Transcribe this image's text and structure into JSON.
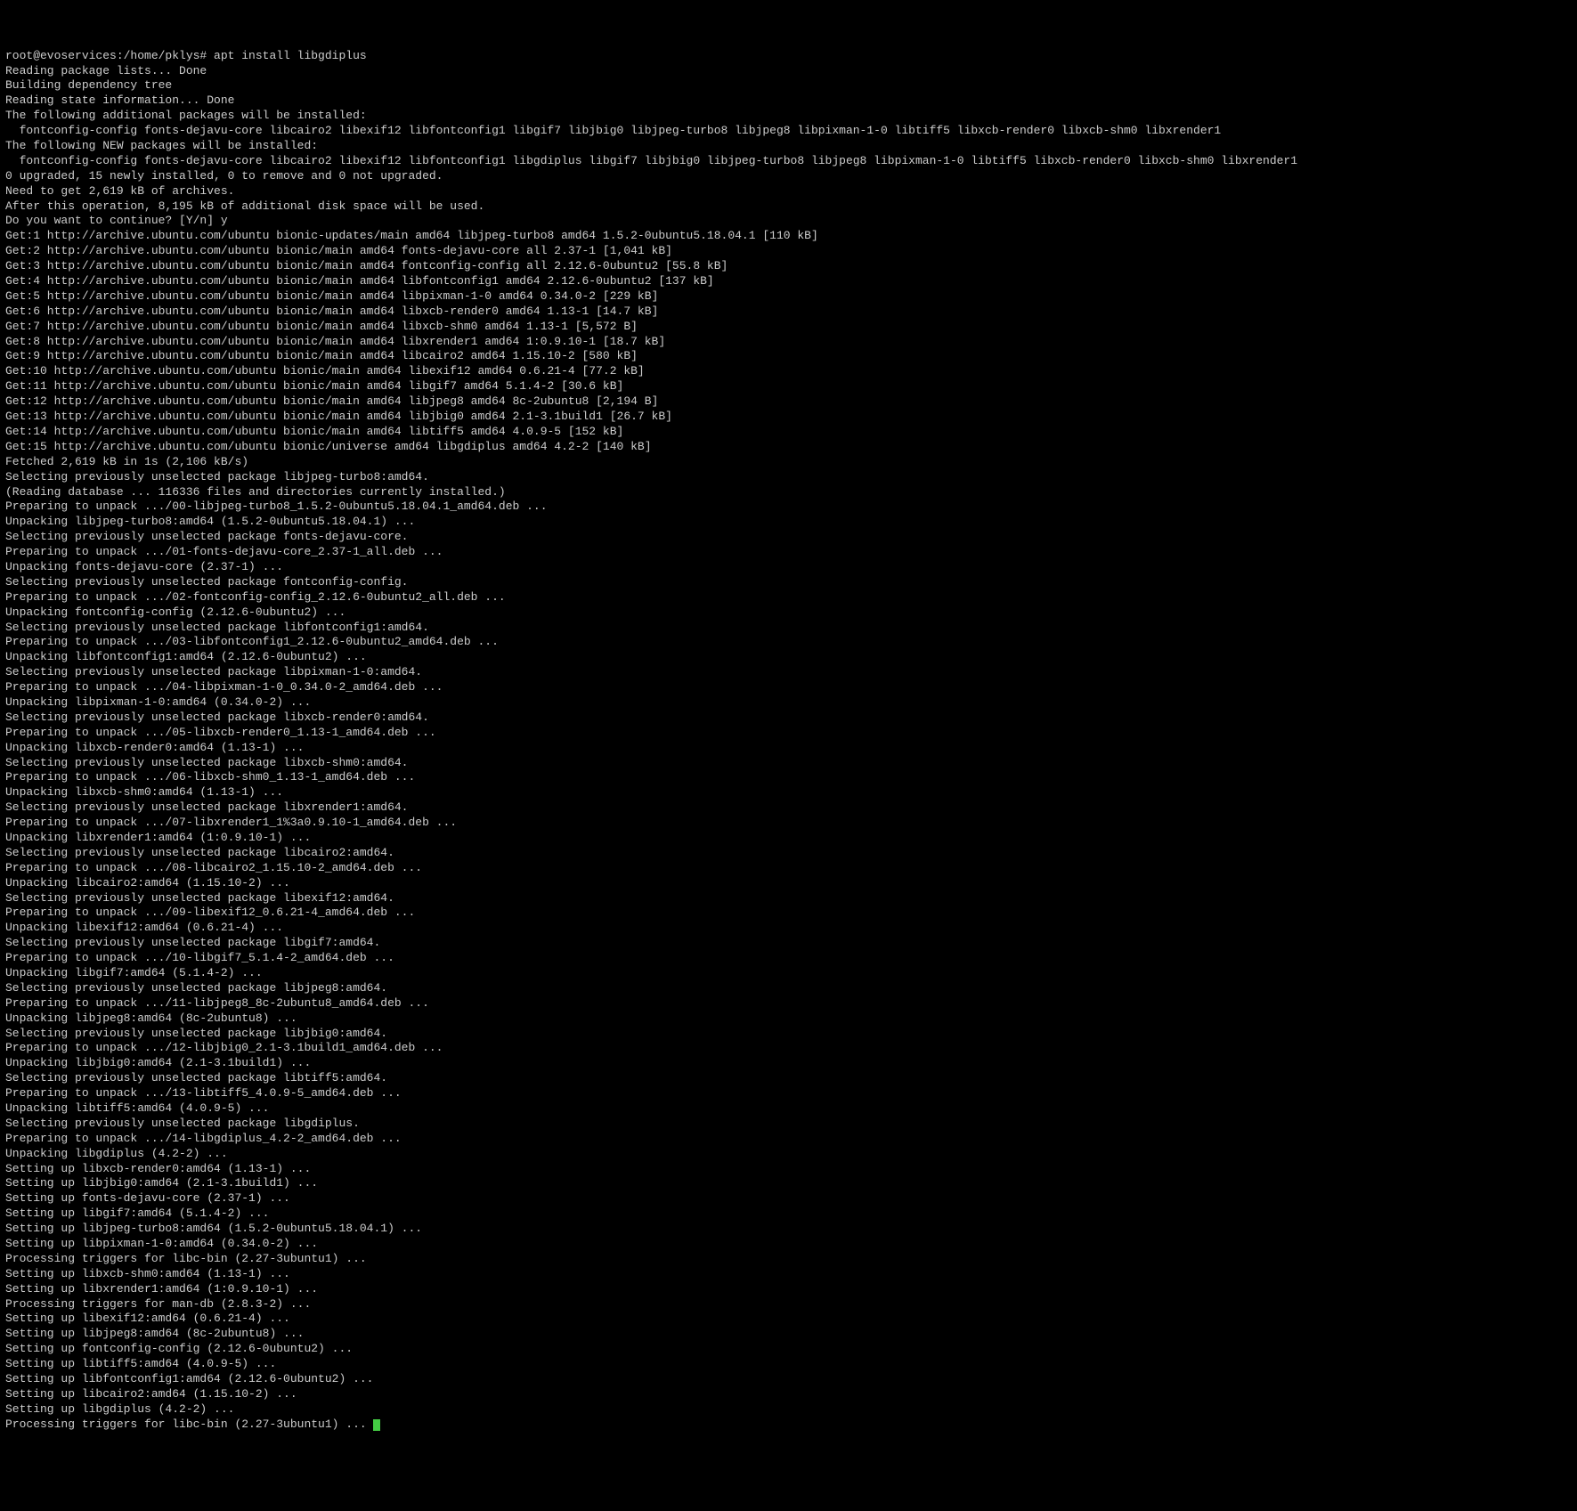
{
  "terminal": {
    "lines": [
      "root@evoservices:/home/pklys# apt install libgdiplus",
      "Reading package lists... Done",
      "Building dependency tree",
      "Reading state information... Done",
      "The following additional packages will be installed:",
      "  fontconfig-config fonts-dejavu-core libcairo2 libexif12 libfontconfig1 libgif7 libjbig0 libjpeg-turbo8 libjpeg8 libpixman-1-0 libtiff5 libxcb-render0 libxcb-shm0 libxrender1",
      "The following NEW packages will be installed:",
      "  fontconfig-config fonts-dejavu-core libcairo2 libexif12 libfontconfig1 libgdiplus libgif7 libjbig0 libjpeg-turbo8 libjpeg8 libpixman-1-0 libtiff5 libxcb-render0 libxcb-shm0 libxrender1",
      "0 upgraded, 15 newly installed, 0 to remove and 0 not upgraded.",
      "Need to get 2,619 kB of archives.",
      "After this operation, 8,195 kB of additional disk space will be used.",
      "Do you want to continue? [Y/n] y",
      "Get:1 http://archive.ubuntu.com/ubuntu bionic-updates/main amd64 libjpeg-turbo8 amd64 1.5.2-0ubuntu5.18.04.1 [110 kB]",
      "Get:2 http://archive.ubuntu.com/ubuntu bionic/main amd64 fonts-dejavu-core all 2.37-1 [1,041 kB]",
      "Get:3 http://archive.ubuntu.com/ubuntu bionic/main amd64 fontconfig-config all 2.12.6-0ubuntu2 [55.8 kB]",
      "Get:4 http://archive.ubuntu.com/ubuntu bionic/main amd64 libfontconfig1 amd64 2.12.6-0ubuntu2 [137 kB]",
      "Get:5 http://archive.ubuntu.com/ubuntu bionic/main amd64 libpixman-1-0 amd64 0.34.0-2 [229 kB]",
      "Get:6 http://archive.ubuntu.com/ubuntu bionic/main amd64 libxcb-render0 amd64 1.13-1 [14.7 kB]",
      "Get:7 http://archive.ubuntu.com/ubuntu bionic/main amd64 libxcb-shm0 amd64 1.13-1 [5,572 B]",
      "Get:8 http://archive.ubuntu.com/ubuntu bionic/main amd64 libxrender1 amd64 1:0.9.10-1 [18.7 kB]",
      "Get:9 http://archive.ubuntu.com/ubuntu bionic/main amd64 libcairo2 amd64 1.15.10-2 [580 kB]",
      "Get:10 http://archive.ubuntu.com/ubuntu bionic/main amd64 libexif12 amd64 0.6.21-4 [77.2 kB]",
      "Get:11 http://archive.ubuntu.com/ubuntu bionic/main amd64 libgif7 amd64 5.1.4-2 [30.6 kB]",
      "Get:12 http://archive.ubuntu.com/ubuntu bionic/main amd64 libjpeg8 amd64 8c-2ubuntu8 [2,194 B]",
      "Get:13 http://archive.ubuntu.com/ubuntu bionic/main amd64 libjbig0 amd64 2.1-3.1build1 [26.7 kB]",
      "Get:14 http://archive.ubuntu.com/ubuntu bionic/main amd64 libtiff5 amd64 4.0.9-5 [152 kB]",
      "Get:15 http://archive.ubuntu.com/ubuntu bionic/universe amd64 libgdiplus amd64 4.2-2 [140 kB]",
      "Fetched 2,619 kB in 1s (2,106 kB/s)",
      "Selecting previously unselected package libjpeg-turbo8:amd64.",
      "(Reading database ... 116336 files and directories currently installed.)",
      "Preparing to unpack .../00-libjpeg-turbo8_1.5.2-0ubuntu5.18.04.1_amd64.deb ...",
      "Unpacking libjpeg-turbo8:amd64 (1.5.2-0ubuntu5.18.04.1) ...",
      "Selecting previously unselected package fonts-dejavu-core.",
      "Preparing to unpack .../01-fonts-dejavu-core_2.37-1_all.deb ...",
      "Unpacking fonts-dejavu-core (2.37-1) ...",
      "Selecting previously unselected package fontconfig-config.",
      "Preparing to unpack .../02-fontconfig-config_2.12.6-0ubuntu2_all.deb ...",
      "Unpacking fontconfig-config (2.12.6-0ubuntu2) ...",
      "Selecting previously unselected package libfontconfig1:amd64.",
      "Preparing to unpack .../03-libfontconfig1_2.12.6-0ubuntu2_amd64.deb ...",
      "Unpacking libfontconfig1:amd64 (2.12.6-0ubuntu2) ...",
      "Selecting previously unselected package libpixman-1-0:amd64.",
      "Preparing to unpack .../04-libpixman-1-0_0.34.0-2_amd64.deb ...",
      "Unpacking libpixman-1-0:amd64 (0.34.0-2) ...",
      "Selecting previously unselected package libxcb-render0:amd64.",
      "Preparing to unpack .../05-libxcb-render0_1.13-1_amd64.deb ...",
      "Unpacking libxcb-render0:amd64 (1.13-1) ...",
      "Selecting previously unselected package libxcb-shm0:amd64.",
      "Preparing to unpack .../06-libxcb-shm0_1.13-1_amd64.deb ...",
      "Unpacking libxcb-shm0:amd64 (1.13-1) ...",
      "Selecting previously unselected package libxrender1:amd64.",
      "Preparing to unpack .../07-libxrender1_1%3a0.9.10-1_amd64.deb ...",
      "Unpacking libxrender1:amd64 (1:0.9.10-1) ...",
      "Selecting previously unselected package libcairo2:amd64.",
      "Preparing to unpack .../08-libcairo2_1.15.10-2_amd64.deb ...",
      "Unpacking libcairo2:amd64 (1.15.10-2) ...",
      "Selecting previously unselected package libexif12:amd64.",
      "Preparing to unpack .../09-libexif12_0.6.21-4_amd64.deb ...",
      "Unpacking libexif12:amd64 (0.6.21-4) ...",
      "Selecting previously unselected package libgif7:amd64.",
      "Preparing to unpack .../10-libgif7_5.1.4-2_amd64.deb ...",
      "Unpacking libgif7:amd64 (5.1.4-2) ...",
      "Selecting previously unselected package libjpeg8:amd64.",
      "Preparing to unpack .../11-libjpeg8_8c-2ubuntu8_amd64.deb ...",
      "Unpacking libjpeg8:amd64 (8c-2ubuntu8) ...",
      "Selecting previously unselected package libjbig0:amd64.",
      "Preparing to unpack .../12-libjbig0_2.1-3.1build1_amd64.deb ...",
      "Unpacking libjbig0:amd64 (2.1-3.1build1) ...",
      "Selecting previously unselected package libtiff5:amd64.",
      "Preparing to unpack .../13-libtiff5_4.0.9-5_amd64.deb ...",
      "Unpacking libtiff5:amd64 (4.0.9-5) ...",
      "Selecting previously unselected package libgdiplus.",
      "Preparing to unpack .../14-libgdiplus_4.2-2_amd64.deb ...",
      "Unpacking libgdiplus (4.2-2) ...",
      "Setting up libxcb-render0:amd64 (1.13-1) ...",
      "Setting up libjbig0:amd64 (2.1-3.1build1) ...",
      "Setting up fonts-dejavu-core (2.37-1) ...",
      "Setting up libgif7:amd64 (5.1.4-2) ...",
      "Setting up libjpeg-turbo8:amd64 (1.5.2-0ubuntu5.18.04.1) ...",
      "Setting up libpixman-1-0:amd64 (0.34.0-2) ...",
      "Processing triggers for libc-bin (2.27-3ubuntu1) ...",
      "Setting up libxcb-shm0:amd64 (1.13-1) ...",
      "Setting up libxrender1:amd64 (1:0.9.10-1) ...",
      "Processing triggers for man-db (2.8.3-2) ...",
      "Setting up libexif12:amd64 (0.6.21-4) ...",
      "Setting up libjpeg8:amd64 (8c-2ubuntu8) ...",
      "Setting up fontconfig-config (2.12.6-0ubuntu2) ...",
      "Setting up libtiff5:amd64 (4.0.9-5) ...",
      "Setting up libfontconfig1:amd64 (2.12.6-0ubuntu2) ...",
      "Setting up libcairo2:amd64 (1.15.10-2) ...",
      "Setting up libgdiplus (4.2-2) ...",
      "Processing triggers for libc-bin (2.27-3ubuntu1) ..."
    ]
  }
}
